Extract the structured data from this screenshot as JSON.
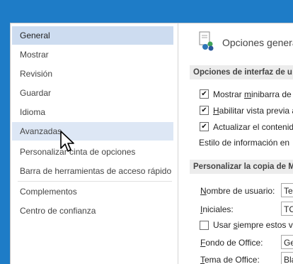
{
  "nav": {
    "items": [
      {
        "label": "General",
        "state": "selected"
      },
      {
        "label": "Mostrar",
        "state": ""
      },
      {
        "label": "Revisión",
        "state": ""
      },
      {
        "label": "Guardar",
        "state": ""
      },
      {
        "label": "Idioma",
        "state": ""
      },
      {
        "label": "Avanzadas",
        "state": "hover"
      },
      {
        "label": "Personalizar cinta de opciones",
        "state": ""
      },
      {
        "label": "Barra de herramientas de acceso rápido",
        "state": ""
      },
      {
        "label": "Complementos",
        "state": ""
      },
      {
        "label": "Centro de confianza",
        "state": ""
      }
    ]
  },
  "main": {
    "title": "Opciones genera",
    "section1": {
      "header": "Opciones de interfaz de u",
      "options": [
        {
          "pre": "Mostrar ",
          "key": "m",
          "post": "inibarra de",
          "checked": true
        },
        {
          "pre": "",
          "key": "H",
          "post": "abilitar vista previa a",
          "checked": true
        },
        {
          "pre": "Actualizar el contenid",
          "key": "",
          "post": "",
          "checked": true
        }
      ],
      "style_label": "Estilo de información en"
    },
    "section2": {
      "header": "Personalizar la copia de M",
      "username_label_key": "N",
      "username_label_rest": "ombre de usuario:",
      "username_value": "Te",
      "initials_label_key": "I",
      "initials_label_rest": "niciales:",
      "initials_value": "TC",
      "always_use": {
        "pre": "Usar ",
        "key": "s",
        "post": "iempre estos va",
        "checked": false
      },
      "background_label_key": "F",
      "background_label_rest": "ondo de Office:",
      "background_value": "Ge",
      "theme_label_key": "T",
      "theme_label_rest": "ema de Office:",
      "theme_value": "Bla"
    }
  },
  "colors": {
    "window_bg": "#1e7cc7",
    "selected": "#cddcf0",
    "hover": "#dde7f5"
  }
}
